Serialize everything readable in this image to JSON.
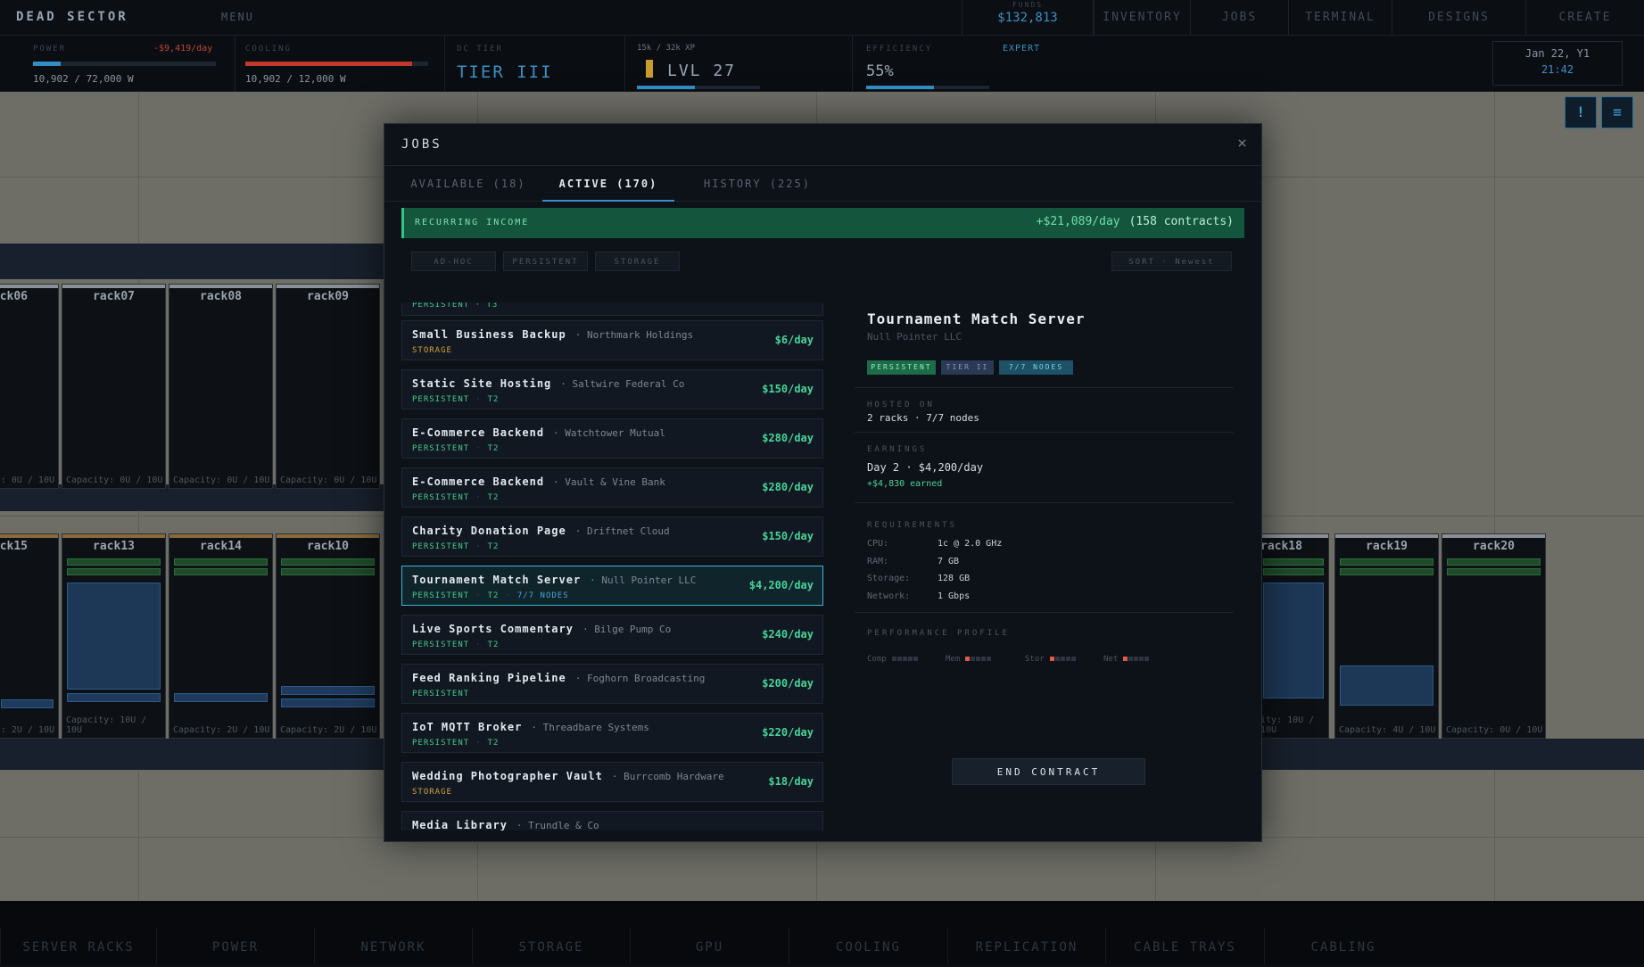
{
  "topbar": {
    "brand": "DEAD SECTOR",
    "menu": "MENU",
    "funds_label": "FUNDS",
    "funds_value": "$132,813",
    "nav": [
      "INVENTORY",
      "JOBS",
      "TERMINAL",
      "DESIGNS",
      "CREATE"
    ]
  },
  "stats": {
    "power_label": "POWER",
    "power_delta": "-$9,419/day",
    "power_value": "10,902 / 72,000 W",
    "power_fill": 0.15,
    "cooling_label": "COOLING",
    "cooling_value": "10,902 / 12,000 W",
    "cooling_fill": 0.91,
    "dc_tier_label": "DC TIER",
    "dc_tier_value": "TIER III",
    "xp_label": "15k / 32k XP",
    "level": "LVL 27",
    "xp_fill": 0.47,
    "efficiency_label": "EFFICIENCY",
    "efficiency_value": "55%",
    "efficiency_fill": 0.55,
    "efficiency_grade": "EXPERT",
    "date": "Jan 22, Y1",
    "time": "21:42",
    "alert_icon": "!",
    "list_icon": "≡"
  },
  "racks_top": [
    "ck06",
    "rack07",
    "rack08",
    "rack09"
  ],
  "racks_top_caps": [
    "Capacity: 0U / 10U",
    "Capacity: 0U / 10U",
    "Capacity: 0U / 10U",
    "Capacity: 0U / 10U"
  ],
  "racks_top_cap_partial": ": 0U / 10U",
  "racks_mid": [
    "ck15",
    "rack13",
    "rack14",
    "rack10"
  ],
  "racks_mid_caps": [
    ": 2U / 10U",
    "Capacity: 10U / 10U",
    "Capacity: 2U / 10U",
    "Capacity: 2U / 10U"
  ],
  "racks_right": [
    "rack18",
    "rack19",
    "rack20"
  ],
  "racks_right_caps": [
    "ity: 10U / 10U",
    "Capacity: 4U / 10U",
    "Capacity: 0U / 10U"
  ],
  "bottom_tabs": [
    "SERVER RACKS",
    "POWER",
    "NETWORK",
    "STORAGE",
    "GPU",
    "COOLING",
    "REPLICATION",
    "CABLE TRAYS",
    "CABLING"
  ],
  "modal": {
    "title": "JOBS",
    "close_icon": "×",
    "tabs": [
      "AVAILABLE (18)",
      "ACTIVE (170)",
      "HISTORY (225)"
    ],
    "income_label": "RECURRING INCOME",
    "income_value": "+$21,089/day",
    "income_contracts": "(158 contracts)",
    "filters": [
      "AD-HOC",
      "PERSISTENT",
      "STORAGE"
    ],
    "sort_label": "SORT · Newest",
    "partial_top_tags": "PERSISTENT · T3",
    "jobs": [
      {
        "name": "Small Business Backup",
        "company": "· Northmark Holdings",
        "type": "STORAGE",
        "tier": "",
        "nodes": "",
        "price": "$6/day"
      },
      {
        "name": "Static Site Hosting",
        "company": "· Saltwire Federal Co",
        "type": "PERSISTENT",
        "tier": "T2",
        "nodes": "",
        "price": "$150/day"
      },
      {
        "name": "E-Commerce Backend",
        "company": "· Watchtower Mutual",
        "type": "PERSISTENT",
        "tier": "T2",
        "nodes": "",
        "price": "$280/day"
      },
      {
        "name": "E-Commerce Backend",
        "company": "· Vault & Vine Bank",
        "type": "PERSISTENT",
        "tier": "T2",
        "nodes": "",
        "price": "$280/day"
      },
      {
        "name": "Charity Donation Page",
        "company": "· Driftnet Cloud",
        "type": "PERSISTENT",
        "tier": "T2",
        "nodes": "",
        "price": "$150/day"
      },
      {
        "name": "Tournament Match Server",
        "company": "· Null Pointer LLC",
        "type": "PERSISTENT",
        "tier": "T2",
        "nodes": "7/7 NODES",
        "price": "$4,200/day"
      },
      {
        "name": "Live Sports Commentary",
        "company": "· Bilge Pump Co",
        "type": "PERSISTENT",
        "tier": "T2",
        "nodes": "",
        "price": "$240/day"
      },
      {
        "name": "Feed Ranking Pipeline",
        "company": "· Foghorn Broadcasting",
        "type": "PERSISTENT",
        "tier": "",
        "nodes": "",
        "price": "$200/day"
      },
      {
        "name": "IoT MQTT Broker",
        "company": "· Threadbare Systems",
        "type": "PERSISTENT",
        "tier": "T2",
        "nodes": "",
        "price": "$220/day"
      },
      {
        "name": "Wedding Photographer Vault",
        "company": "· Burrcomb Hardware",
        "type": "STORAGE",
        "tier": "",
        "nodes": "",
        "price": "$18/day"
      },
      {
        "name": "Media Library",
        "company": "· Trundle & Co",
        "type": "",
        "tier": "",
        "nodes": "",
        "price": ""
      }
    ],
    "detail": {
      "title": "Tournament Match Server",
      "company": "Null Pointer LLC",
      "badges": [
        "PERSISTENT",
        "TIER II",
        "7/7 NODES"
      ],
      "hosted_label": "HOSTED ON",
      "hosted_value": "2 racks · 7/7 nodes",
      "earnings_label": "EARNINGS",
      "earnings_value": "Day 2 · $4,200/day",
      "earned": "+$4,830 earned",
      "req_label": "REQUIREMENTS",
      "requirements": [
        {
          "k": "CPU:",
          "v": "1c @ 2.0 GHz"
        },
        {
          "k": "RAM:",
          "v": "7 GB"
        },
        {
          "k": "Storage:",
          "v": "128 GB"
        },
        {
          "k": "Network:",
          "v": "1 Gbps"
        }
      ],
      "perf_label": "PERFORMANCE PROFILE",
      "perf": [
        {
          "k": "Comp",
          "level": 0
        },
        {
          "k": "Mem",
          "level": 1
        },
        {
          "k": "Stor",
          "level": 1
        },
        {
          "k": "Net",
          "level": 1
        }
      ],
      "end_button": "END CONTRACT"
    }
  }
}
